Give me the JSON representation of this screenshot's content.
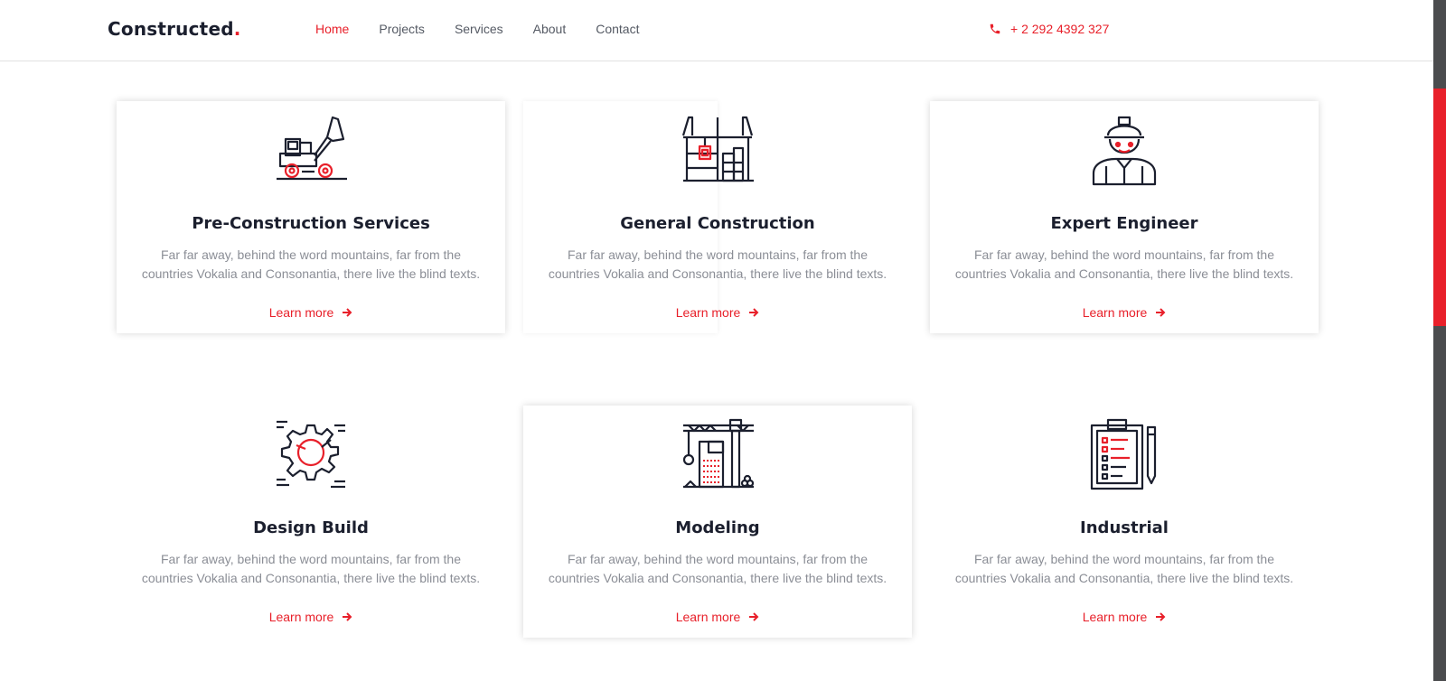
{
  "header": {
    "brand": "Constructed",
    "brand_dot": ".",
    "nav": [
      "Home",
      "Projects",
      "Services",
      "About",
      "Contact"
    ],
    "active_nav": "Home",
    "phone": "+ 2 292 4392 327"
  },
  "colors": {
    "accent": "#e8202a",
    "dark": "#1b1f2e",
    "muted_text": "#8b8e96",
    "scrollbar": "#4b4c4e"
  },
  "services": [
    {
      "title": "Pre-Construction Services",
      "description": "Far far away, behind the word mountains, far from the countries Vokalia and Consonantia, there live the blind texts.",
      "link": "Learn more",
      "icon": "bulldozer-icon"
    },
    {
      "title": "General Construction",
      "description": "Far far away, behind the word mountains, far from the countries Vokalia and Consonantia, there live the blind texts.",
      "link": "Learn more",
      "icon": "crane-building-icon"
    },
    {
      "title": "Expert Engineer",
      "description": "Far far away, behind the word mountains, far from the countries Vokalia and Consonantia, there live the blind texts.",
      "link": "Learn more",
      "icon": "engineer-icon"
    },
    {
      "title": "Design Build",
      "description": "Far far away, behind the word mountains, far from the countries Vokalia and Consonantia, there live the blind texts.",
      "link": "Learn more",
      "icon": "gear-icon"
    },
    {
      "title": "Modeling",
      "description": "Far far away, behind the word mountains, far from the countries Vokalia and Consonantia, there live the blind texts.",
      "link": "Learn more",
      "icon": "tower-crane-icon"
    },
    {
      "title": "Industrial",
      "description": "Far far away, behind the word mountains, far from the countries Vokalia and Consonantia, there live the blind texts.",
      "link": "Learn more",
      "icon": "clipboard-icon"
    }
  ]
}
